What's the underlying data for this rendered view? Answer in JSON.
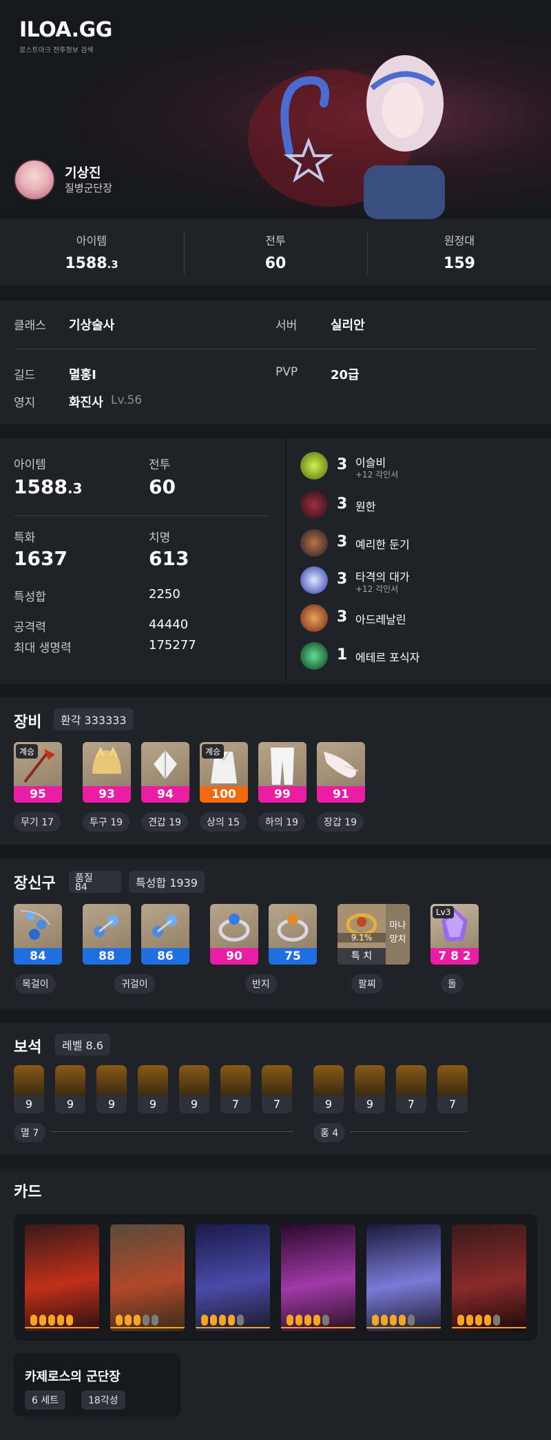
{
  "header": {
    "logo": "ILOA.GG",
    "tagline": "로스트아크 전투정보 검색"
  },
  "character": {
    "name": "기상진",
    "title": "질병군단장"
  },
  "top_stats": [
    {
      "label": "아이템",
      "value_main": "1588",
      "value_sub": ".3"
    },
    {
      "label": "전투",
      "value_main": "60",
      "value_sub": ""
    },
    {
      "label": "원정대",
      "value_main": "159",
      "value_sub": ""
    }
  ],
  "info": {
    "class_label": "클래스",
    "class_value": "기상술사",
    "server_label": "서버",
    "server_value": "실리안",
    "guild_label": "길드",
    "guild_value": "멸홍I",
    "pvp_label": "PVP",
    "pvp_value": "20급",
    "estate_label": "영지",
    "estate_value": "화진사",
    "estate_level": "Lv.56"
  },
  "detail": {
    "item_label": "아이템",
    "item_main": "1588",
    "item_sub": ".3",
    "combat_label": "전투",
    "combat_value": "60",
    "spec_label": "특화",
    "spec_value": "1637",
    "crit_label": "치명",
    "crit_value": "613",
    "stat_sum_label": "특성합",
    "stat_sum_value": "2250",
    "atk_label": "공격력",
    "atk_value": "44440",
    "hp_label": "최대 생명력",
    "hp_value": "175277"
  },
  "engravings": [
    {
      "level": "3",
      "name": "이슬비",
      "sub": "+12 각인서",
      "color": "#9bc21a"
    },
    {
      "level": "3",
      "name": "원한",
      "sub": "",
      "color": "#6b1e22"
    },
    {
      "level": "3",
      "name": "예리한 둔기",
      "sub": "",
      "color": "#3b3f55"
    },
    {
      "level": "3",
      "name": "타격의 대가",
      "sub": "+12 각인서",
      "color": "#4a5ad8"
    },
    {
      "level": "3",
      "name": "아드레날린",
      "sub": "",
      "color": "#c0652a"
    },
    {
      "level": "1",
      "name": "에테르 포식자",
      "sub": "",
      "color": "#1f8f4a"
    }
  ],
  "equipment": {
    "title": "장비",
    "badge": "환각 333333",
    "items": [
      {
        "tag": "계승",
        "quality": "95",
        "bar_color": "#e91ea5",
        "label": "무기 17",
        "icon": "staff-icon"
      },
      {
        "tag": "",
        "quality": "93",
        "bar_color": "#e91ea5",
        "label": "투구 19",
        "icon": "helmet-icon"
      },
      {
        "tag": "",
        "quality": "94",
        "bar_color": "#e91ea5",
        "label": "견갑 19",
        "icon": "shoulder-icon"
      },
      {
        "tag": "계승",
        "quality": "100",
        "bar_color": "#f26a0f",
        "label": "상의 15",
        "icon": "top-icon"
      },
      {
        "tag": "",
        "quality": "99",
        "bar_color": "#e91ea5",
        "label": "하의 19",
        "icon": "pants-icon"
      },
      {
        "tag": "",
        "quality": "91",
        "bar_color": "#e91ea5",
        "label": "장갑 19",
        "icon": "gloves-icon"
      }
    ]
  },
  "accessories": {
    "title": "장신구",
    "quality_label": "품질",
    "quality_value": "84",
    "stat_badge": "특성합 1939",
    "items": [
      {
        "value": "84",
        "bar_color": "#1f6fe0"
      },
      {
        "value": "88",
        "bar_color": "#1f6fe0"
      },
      {
        "value": "86",
        "bar_color": "#1f6fe0"
      },
      {
        "value": "90",
        "bar_color": "#e91ea5"
      },
      {
        "value": "75",
        "bar_color": "#1f6fe0"
      }
    ],
    "labels": [
      "목걸이",
      "귀걸이",
      "반지",
      "팔찌",
      "돌"
    ],
    "bracelet": {
      "percent": "9.1%",
      "stat": "특 치",
      "side": "마나 망치"
    },
    "stone": {
      "level": "Lv3",
      "value": "7 8 2"
    }
  },
  "gems": {
    "title": "보석",
    "badge": "레벨 8.6",
    "left": [
      "9",
      "9",
      "9",
      "9",
      "9",
      "7",
      "7"
    ],
    "right": [
      "9",
      "9",
      "7",
      "7"
    ],
    "left_label": "멸 7",
    "right_label": "홍 4"
  },
  "cards": {
    "title": "카드",
    "items": [
      {
        "on": 5,
        "color": "#8a2020"
      },
      {
        "on": 3,
        "color": "#7a5a4a"
      },
      {
        "on": 4,
        "color": "#3a3f8a"
      },
      {
        "on": 4,
        "color": "#6a2a6a"
      },
      {
        "on": 4,
        "color": "#5a5a9a"
      },
      {
        "on": 4,
        "color": "#5a2a2a"
      }
    ],
    "set_name": "카제로스의 군단장",
    "set_count": "6 세트",
    "awaken": "18각성"
  }
}
